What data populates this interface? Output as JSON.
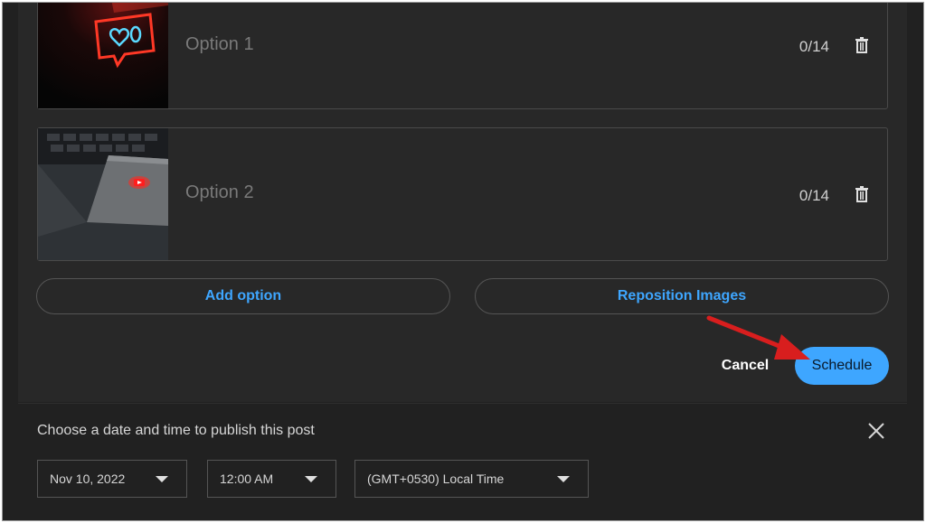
{
  "options": [
    {
      "label": "Option 1",
      "counter": "0/14",
      "image_icon": "neon-heart-like-sign-image"
    },
    {
      "label": "Option 2",
      "counter": "0/14",
      "image_icon": "laptop-youtube-logo-image"
    }
  ],
  "actions": {
    "add_option": "Add option",
    "reposition_images": "Reposition Images",
    "cancel": "Cancel",
    "schedule": "Schedule"
  },
  "scheduler": {
    "title": "Choose a date and time to publish this post",
    "date": "Nov 10, 2022",
    "time": "12:00 AM",
    "timezone": "(GMT+0530) Local Time"
  },
  "colors": {
    "accent": "#3ea6ff",
    "annotation_arrow": "#d81e1e",
    "background": "#212121",
    "panel": "#282828"
  },
  "icons": {
    "delete": "trash-icon",
    "close": "close-icon",
    "dropdown": "caret-down-icon"
  }
}
